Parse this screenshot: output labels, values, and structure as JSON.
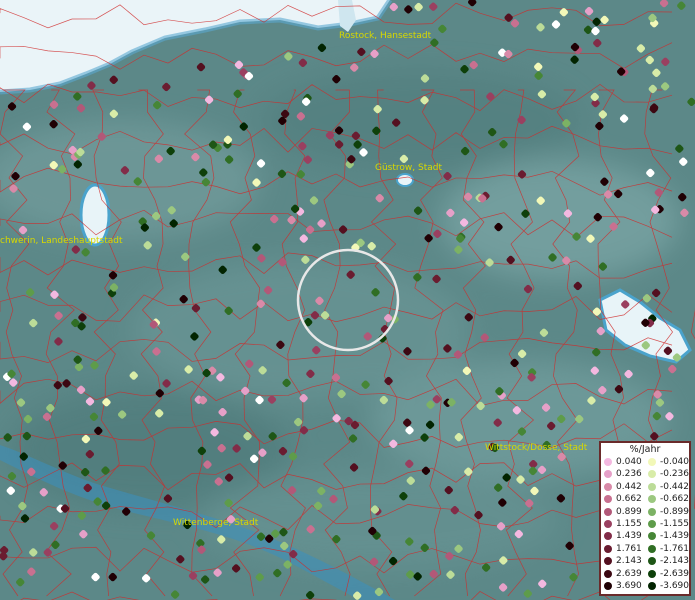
{
  "cities": [
    {
      "name": "Rostock, Hansestadt",
      "label": "Rostock, Hansestadt"
    },
    {
      "name": "Güstrow, Stadt",
      "label": "Güstrow, Stadt"
    },
    {
      "name": "Schwerin, Landeshauptstadt",
      "label": "chwerin, Landeshauptstadt"
    },
    {
      "name": "Wittstock/Dosse, Stadt",
      "label": "Wittstock/Dosse, Stadt"
    },
    {
      "name": "Wittenberge, Stadt",
      "label": "Wittenberge, Stadt"
    }
  ],
  "legend": {
    "title": "%/Jahr",
    "positive": [
      {
        "value": "0.040",
        "color": "#f4b8e0"
      },
      {
        "value": "0.236",
        "color": "#e6a0c8"
      },
      {
        "value": "0.442",
        "color": "#d98aa8"
      },
      {
        "value": "0.662",
        "color": "#c97090"
      },
      {
        "value": "0.899",
        "color": "#b25878"
      },
      {
        "value": "1.155",
        "color": "#9a4060"
      },
      {
        "value": "1.439",
        "color": "#822c48"
      },
      {
        "value": "1.761",
        "color": "#6a1c30"
      },
      {
        "value": "2.143",
        "color": "#541020"
      },
      {
        "value": "2.639",
        "color": "#3c0812"
      },
      {
        "value": "3.690",
        "color": "#200004"
      }
    ],
    "negative": [
      {
        "value": "-0.040",
        "color": "#f2f8b8"
      },
      {
        "value": "-0.236",
        "color": "#d8eca8"
      },
      {
        "value": "-0.442",
        "color": "#bcdc98"
      },
      {
        "value": "-0.662",
        "color": "#9cc880"
      },
      {
        "value": "-0.899",
        "color": "#7cb264"
      },
      {
        "value": "-1.155",
        "color": "#5e9c4a"
      },
      {
        "value": "-1.439",
        "color": "#468636"
      },
      {
        "value": "-1.761",
        "color": "#306e24"
      },
      {
        "value": "-2.143",
        "color": "#1e5616"
      },
      {
        "value": "-2.639",
        "color": "#0e400a"
      },
      {
        "value": "-3.690",
        "color": "#022400"
      }
    ]
  }
}
